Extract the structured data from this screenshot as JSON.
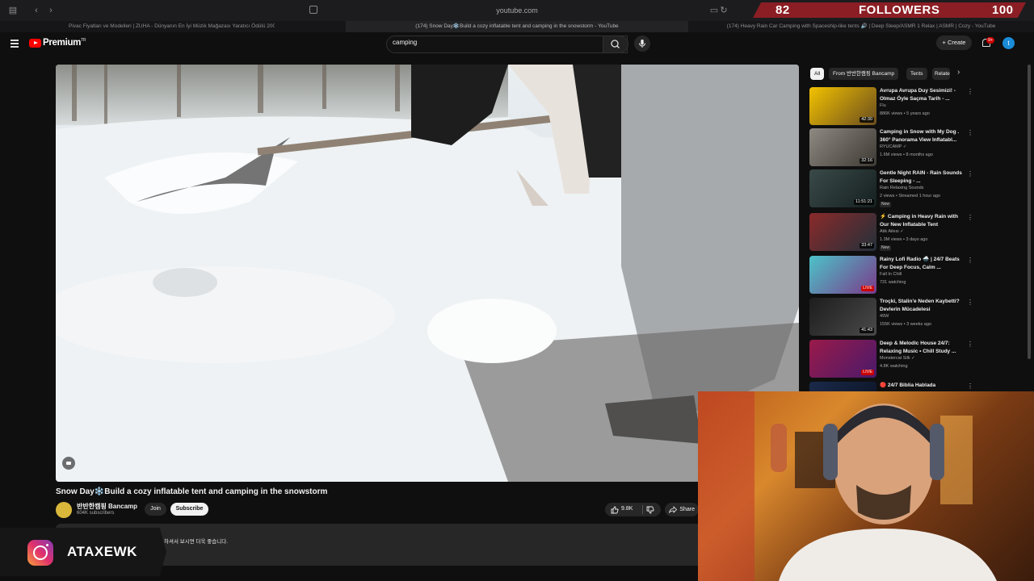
{
  "browser": {
    "url": "youtube.com",
    "tabs": [
      "Pivac Fiyatları ve Modelleri | ZUHA - Dünyanın En İyi Müzik Mağazası Yaratıcı Ödülü 2008",
      "(174) Snow Day❄️Build a cozy inflatable tent and camping in the snowstorm - YouTube",
      "(174) Heavy Rain Car Camping with Spaceship-like tents 🔊 | Deep Sleep/ASMR 1 Relax | ASMR | Cozy - YouTube"
    ]
  },
  "stream_overlay": {
    "followers_current": "82",
    "followers_label": "FOLLOWERS",
    "followers_goal": "100",
    "instagram_handle": "ATAXEWK"
  },
  "header": {
    "logo_text": "Premium",
    "logo_region": "TR",
    "search_value": "camping",
    "create_label": "Create",
    "notification_count": "9+",
    "avatar_initial": "t"
  },
  "video": {
    "title": "Snow Day❄️Build a cozy inflatable tent and camping in the snowstorm",
    "channel": "반반한캠핑 Bancamp",
    "subscribers": "604K subscribers",
    "join_label": "Join",
    "subscribe_label": "Subscribe",
    "likes": "9.8K",
    "share_label": "Share",
    "description_snippet": "하셔서 보시면 더욱 좋습니다."
  },
  "chips": [
    "All",
    "From 반반한캠핑 Bancamp",
    "Tents",
    "Related"
  ],
  "recommendations": [
    {
      "title": "Avrupa Avrupa Duy Sesimizi! - Olmaz Öyle Saçma Tarih - ...",
      "channel": "Flu",
      "meta": "886K views • 5 years ago",
      "duration": "42:30",
      "badge": "",
      "colors": [
        "#f2c200",
        "#6b4d1e"
      ]
    },
    {
      "title": "Camping in Snow with My Dog . 360° Panorama View Inflatabl...",
      "channel": "RYUCAMP ✓",
      "meta": "1.6M views • 8 months ago",
      "duration": "32:16",
      "badge": "",
      "colors": [
        "#8e8a82",
        "#3e3a34"
      ]
    },
    {
      "title": "Gentle Night RAIN - Rain Sounds For Sleeping - ...",
      "channel": "Rain Relaxing Sounds",
      "meta": "2 views • Streamed 1 hour ago",
      "duration": "11:51:21",
      "badge": "New",
      "colors": [
        "#3a4a48",
        "#152020"
      ]
    },
    {
      "title": "⚡ Camping in Heavy Rain with Our New Inflatable Tent",
      "channel": "Atik Ailesi ✓",
      "meta": "1.3M views • 3 days ago",
      "duration": "33:47",
      "badge": "New",
      "colors": [
        "#8a2a2a",
        "#23303a"
      ]
    },
    {
      "title": "Rainy Lofi Radio 🌧️ | 24/7 Beats For Deep Focus, Calm ...",
      "channel": "Fall In Chill",
      "meta": "731 watching",
      "duration": "LIVE",
      "badge": "",
      "colors": [
        "#4cc3c9",
        "#7a3a8a"
      ]
    },
    {
      "title": "Troçki, Stalin'e Neden Kaybetti? Devlerin Mücadelesi",
      "channel": "49W",
      "meta": "155K views • 3 weeks ago",
      "duration": "41:43",
      "badge": "",
      "colors": [
        "#1d1d1d",
        "#4a4a4a"
      ]
    },
    {
      "title": "Deep & Melodic House 24/7: Relaxing Music • Chill Study ...",
      "channel": "Monstercat Silk ✓",
      "meta": "4.8K watching",
      "duration": "LIVE",
      "badge": "",
      "colors": [
        "#9a1a4a",
        "#4a1a6a"
      ]
    },
    {
      "title": "🔴 24/7 Biblia Hablada",
      "channel": "",
      "meta": "",
      "duration": "",
      "badge": "",
      "colors": [
        "#1a2a4a",
        "#0a1020"
      ]
    }
  ]
}
